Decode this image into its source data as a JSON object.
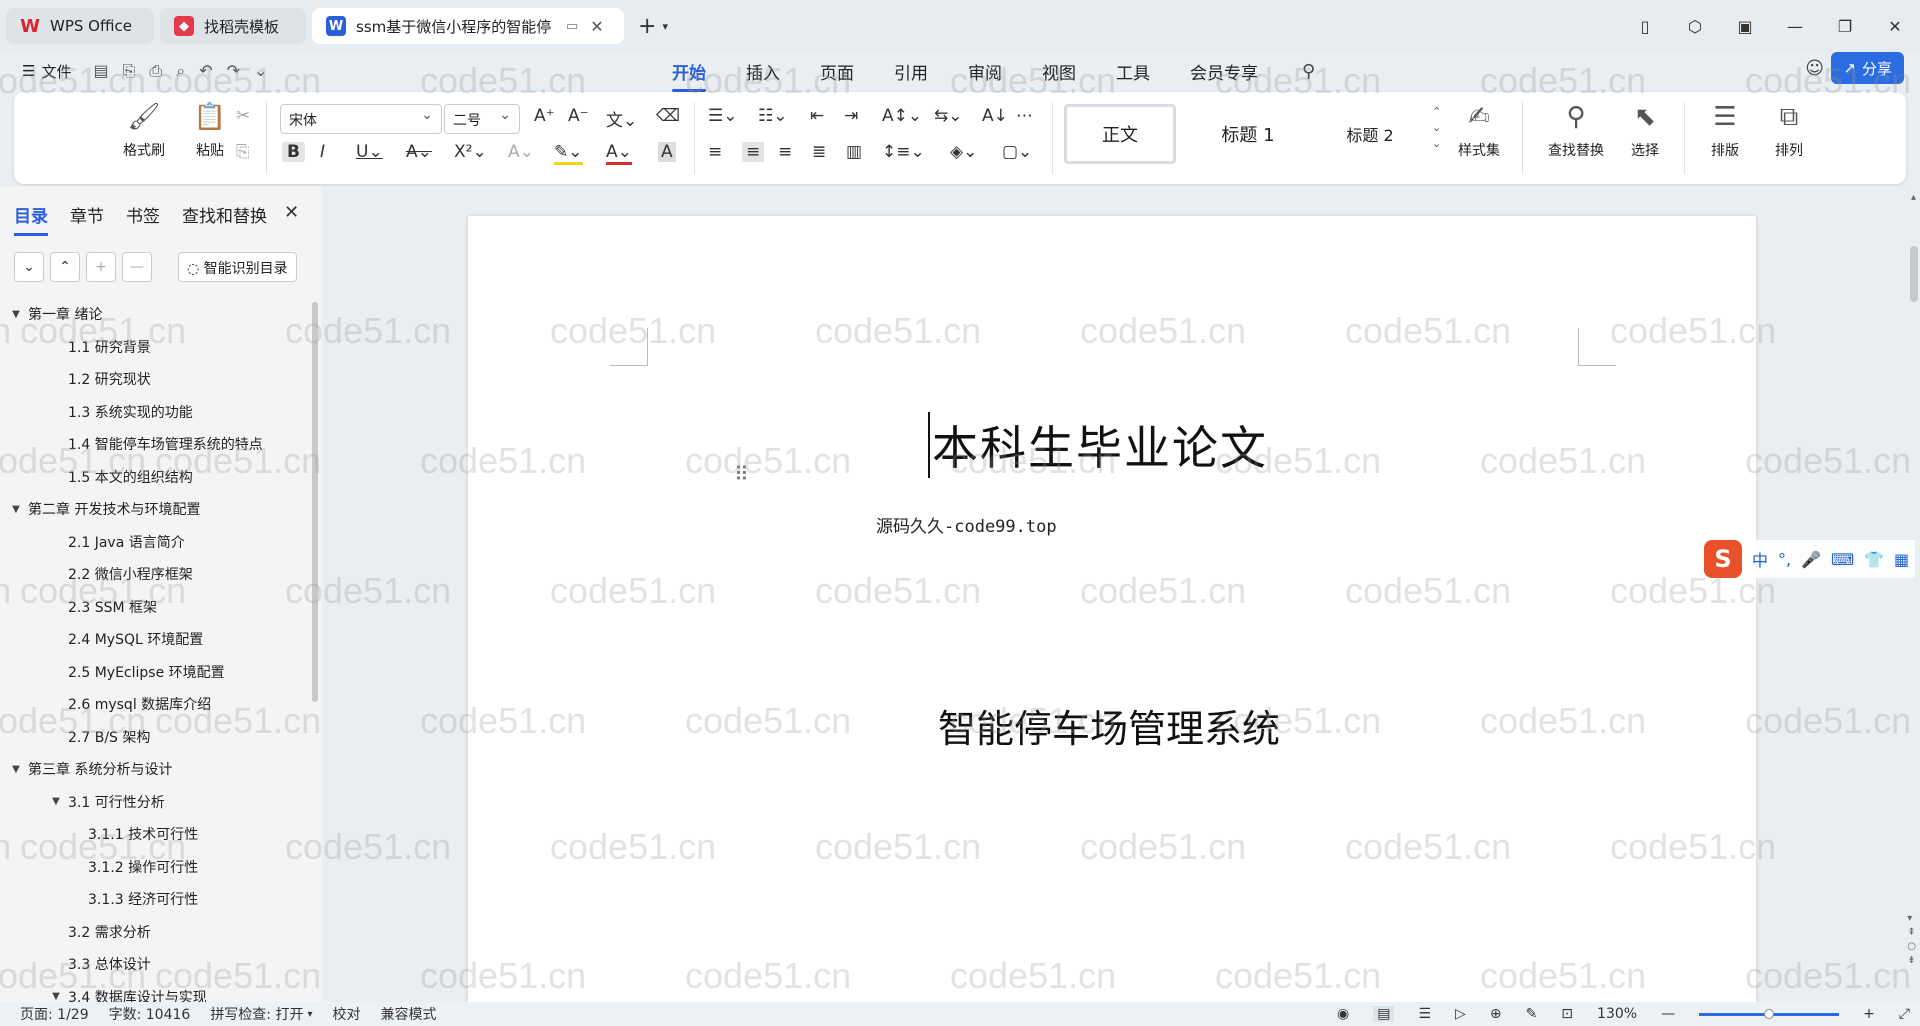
{
  "tabs": [
    {
      "label": "WPS Office",
      "icon": "wps-logo-icon",
      "color": "#d9262c"
    },
    {
      "label": "找稻壳模板",
      "icon": "docer-icon",
      "color": "#e23b4a"
    },
    {
      "label": "ssm基于微信小程序的智能停",
      "icon": "word-doc-icon",
      "color": "#2b5fd9"
    }
  ],
  "menu": {
    "file": "文件",
    "tabs": [
      "开始",
      "插入",
      "页面",
      "引用",
      "审阅",
      "视图",
      "工具",
      "会员专享"
    ],
    "active_tab": "开始",
    "share": "分享"
  },
  "ribbon": {
    "format_painter": "格式刷",
    "paste": "粘贴",
    "font_name": "宋体",
    "font_size": "二号",
    "styles": [
      "正文",
      "标题 1",
      "标题 2"
    ],
    "style_set": "样式集",
    "find_replace": "查找替换",
    "select": "选择",
    "layout": "排版",
    "arrange": "排列"
  },
  "left_panel": {
    "tabs": [
      "目录",
      "章节",
      "书签",
      "查找和替换"
    ],
    "active_tab": "目录",
    "ai_button": "智能识别目录",
    "toc": [
      {
        "text": "第一章  绪论",
        "level": 0,
        "expanded": true
      },
      {
        "text": "1.1    研究背景",
        "level": 1
      },
      {
        "text": "1.2    研究现状",
        "level": 1
      },
      {
        "text": "1.3    系统实现的功能",
        "level": 1
      },
      {
        "text": "1.4    智能停车场管理系统的特点",
        "level": 1
      },
      {
        "text": "1.5    本文的组织结构",
        "level": 1
      },
      {
        "text": "第二章  开发技术与环境配置",
        "level": 0,
        "expanded": true
      },
      {
        "text": "2.1    Java 语言简介",
        "level": 1
      },
      {
        "text": "2.2    微信小程序框架",
        "level": 1
      },
      {
        "text": "2.3    SSM 框架",
        "level": 1
      },
      {
        "text": "2.4    MySQL 环境配置",
        "level": 1
      },
      {
        "text": "2.5    MyEclipse 环境配置",
        "level": 1
      },
      {
        "text": "2.6    mysql 数据库介绍",
        "level": 1
      },
      {
        "text": "2.7    B/S 架构",
        "level": 1
      },
      {
        "text": "第三章  系统分析与设计",
        "level": 0,
        "expanded": true
      },
      {
        "text": "3.1  可行性分析",
        "level": 1,
        "expanded": true
      },
      {
        "text": "3.1.1  技术可行性",
        "level": 2
      },
      {
        "text": "3.1.2  操作可行性",
        "level": 2
      },
      {
        "text": "3.1.3 经济可行性",
        "level": 2
      },
      {
        "text": "3.2    需求分析",
        "level": 1
      },
      {
        "text": "3.3    总体设计",
        "level": 1
      },
      {
        "text": "3.4    数据库设计与实现",
        "level": 1,
        "expanded": true
      }
    ]
  },
  "document": {
    "title": "本科生毕业论文",
    "note": "源码久久-code99.top",
    "system_title": "智能停车场管理系统"
  },
  "ime": {
    "lang": "中"
  },
  "status": {
    "page": "页面: 1/29",
    "words": "字数: 10416",
    "spell": "拼写检查: 打开",
    "proofread": "校对",
    "compat": "兼容模式",
    "zoom": "130%",
    "zoom_level": 0.5
  },
  "watermark": "code51.cn"
}
